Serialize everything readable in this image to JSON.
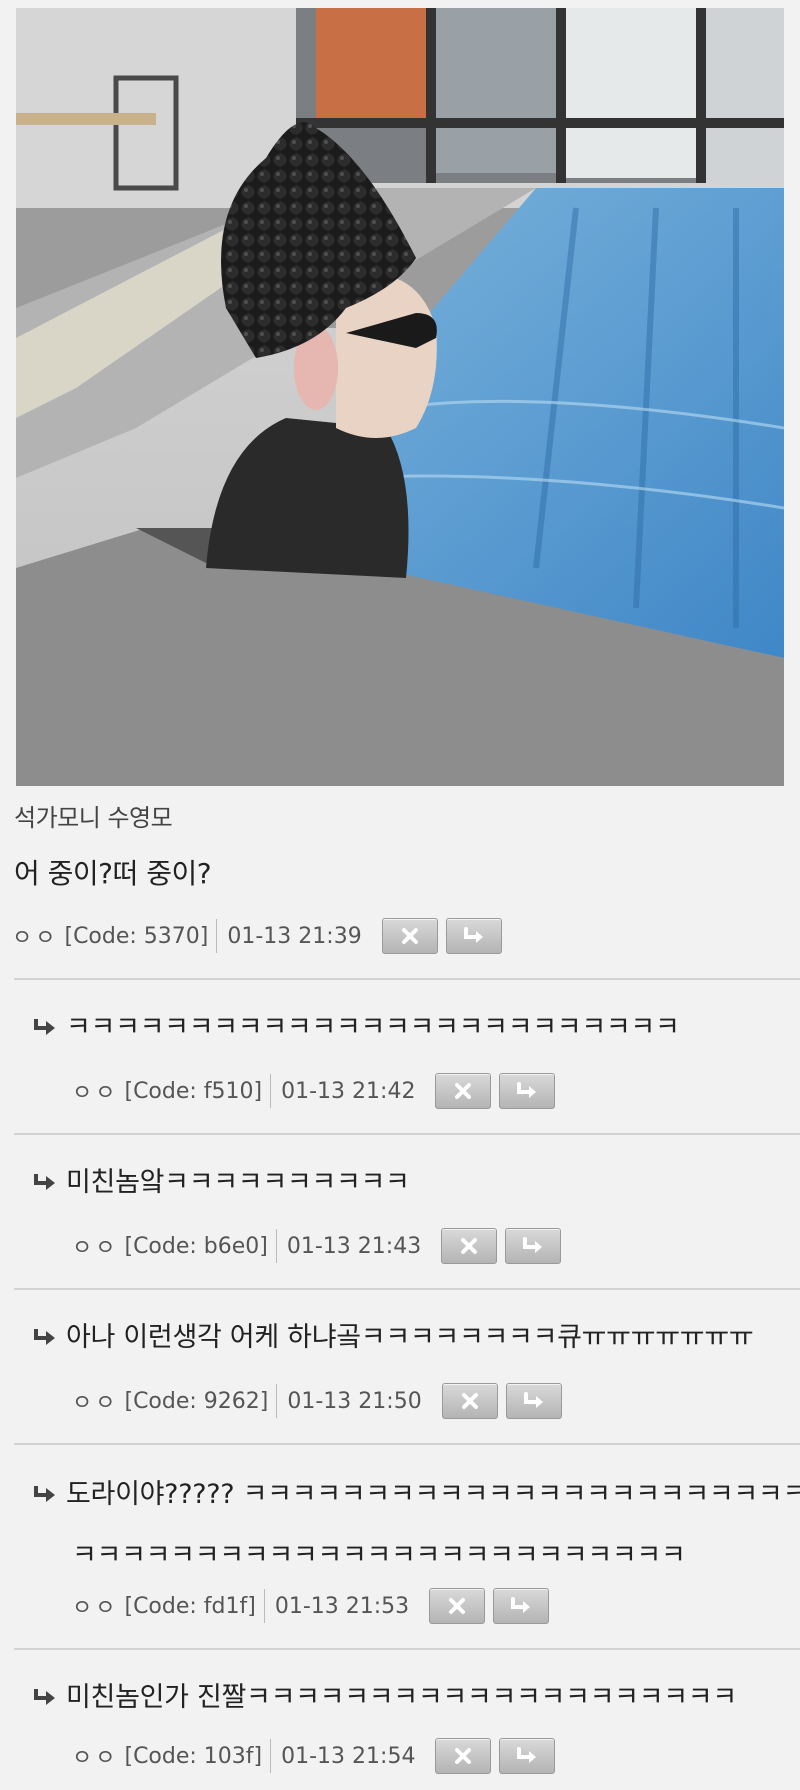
{
  "post": {
    "title": "석가모니 수영모",
    "body": "어 중이?떠 중이?",
    "author": "ㅇㅇ",
    "code": "[Code: 5370]",
    "time": "01-13 21:39"
  },
  "replies": [
    {
      "text": "ㅋㅋㅋㅋㅋㅋㅋㅋㅋㅋㅋㅋㅋㅋㅋㅋㅋㅋㅋㅋㅋㅋㅋㅋㅋ",
      "text2": "",
      "author": "ㅇㅇ",
      "code": "[Code: f510]",
      "time": "01-13 21:42"
    },
    {
      "text": "미친놈앜ㅋㅋㅋㅋㅋㅋㅋㅋㅋㅋ",
      "text2": "",
      "author": "ㅇㅇ",
      "code": "[Code: b6e0]",
      "time": "01-13 21:43"
    },
    {
      "text": "아나 이런생각 어케 하냐곸ㅋㅋㅋㅋㅋㅋㅋㅋ큐ㅠㅠㅠㅠㅠㅠㅠ",
      "text2": "",
      "author": "ㅇㅇ",
      "code": "[Code: 9262]",
      "time": "01-13 21:50"
    },
    {
      "text": "도라이야????? ㅋㅋㅋㅋㅋㅋㅋㅋㅋㅋㅋㅋㅋㅋㅋㅋㅋㅋㅋㅋㅋㅋㅋㅋ",
      "text2": "ㅋㅋㅋㅋㅋㅋㅋㅋㅋㅋㅋㅋㅋㅋㅋㅋㅋㅋㅋㅋㅋㅋㅋㅋㅋ",
      "author": "ㅇㅇ",
      "code": "[Code: fd1f]",
      "time": "01-13 21:53"
    },
    {
      "text": "미친놈인가 진짤ㅋㅋㅋㅋㅋㅋㅋㅋㅋㅋㅋㅋㅋㅋㅋㅋㅋㅋㅋㅋ",
      "text2": "",
      "author": "ㅇㅇ",
      "code": "[Code: 103f]",
      "time": "01-13 21:54"
    }
  ],
  "buttons": {
    "delete_icon": "close-icon",
    "reply_icon": "reply-arrow-icon"
  },
  "colors": {
    "background": "#f2f2f2",
    "button": "#c8c8c8",
    "divider": "#d3d3d3"
  }
}
